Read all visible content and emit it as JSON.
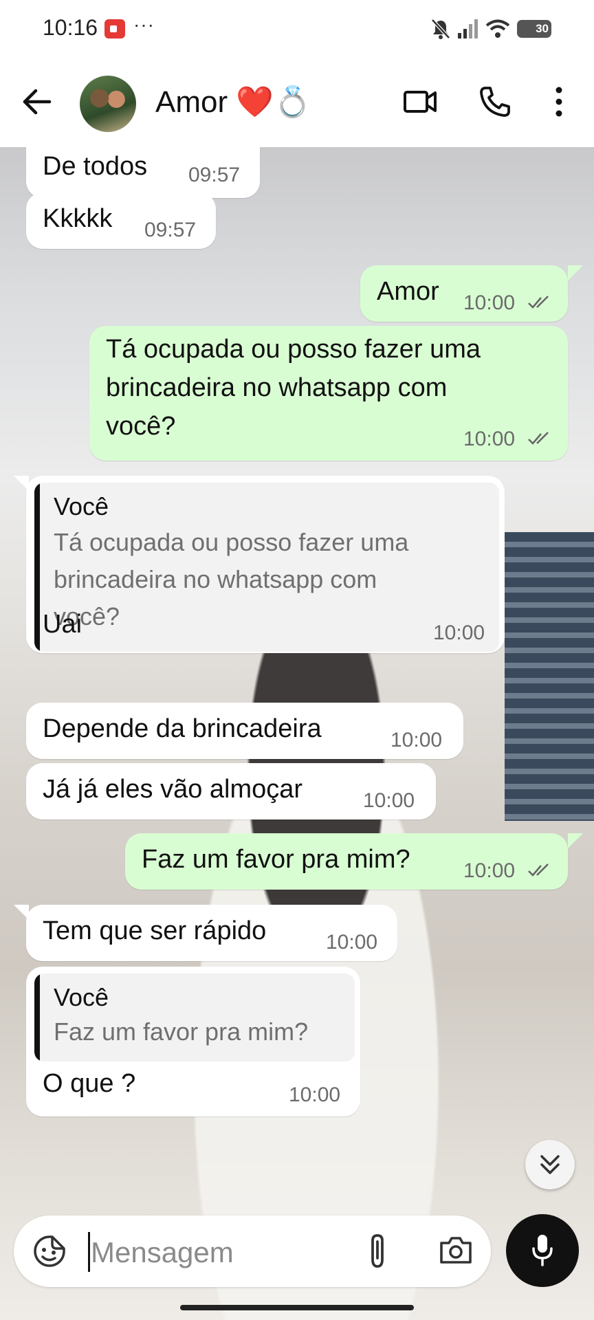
{
  "status_bar": {
    "time": "10:16",
    "more": "···",
    "battery": "30"
  },
  "header": {
    "contact_name": "Amor ❤️💍"
  },
  "messages": [
    {
      "text": "De todos",
      "time": "09:57"
    },
    {
      "text": "Kkkkk",
      "time": "09:57"
    },
    {
      "text": "Amor",
      "time": "10:00"
    },
    {
      "lines": [
        "Tá ocupada ou posso fazer uma",
        "brincadeira no whatsapp com",
        "você?"
      ],
      "time": "10:00"
    },
    {
      "quote_author": "Você",
      "quote_lines": [
        "Tá ocupada ou posso fazer uma",
        "brincadeira no whatsapp com",
        "você?"
      ],
      "text": "Uai",
      "time": "10:00"
    },
    {
      "text": "Depende da brincadeira",
      "time": "10:00"
    },
    {
      "text": "Já já eles vão almoçar",
      "time": "10:00"
    },
    {
      "text": "Faz um favor pra mim?",
      "time": "10:00"
    },
    {
      "text": "Tem que ser rápido",
      "time": "10:00"
    },
    {
      "quote_author": "Você",
      "quote_text": "Faz um favor pra mim?",
      "text": "O que ?",
      "time": "10:00"
    }
  ],
  "input": {
    "placeholder": "Mensagem"
  },
  "icons": {
    "back": "arrow-left-icon",
    "video": "video-call-icon",
    "call": "phone-icon",
    "menu": "more-vert-icon",
    "emoji": "sticker-icon",
    "attach": "paperclip-icon",
    "camera": "camera-icon",
    "mic": "mic-icon",
    "scroll": "double-chevron-down-icon",
    "ticks": "double-check-icon"
  },
  "colors": {
    "outgoing_bubble": "#d9fdd3",
    "incoming_bubble": "#ffffff",
    "mic_button": "#111111",
    "record_badge": "#e53935"
  }
}
